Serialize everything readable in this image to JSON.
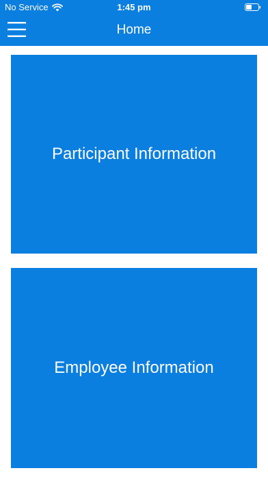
{
  "status_bar": {
    "carrier": "No Service",
    "time": "1:45 pm",
    "wifi_icon": "wifi-icon",
    "battery_icon": "battery-icon"
  },
  "nav": {
    "title": "Home",
    "menu_icon": "hamburger-menu-icon"
  },
  "tiles": [
    {
      "label": "Participant Information"
    },
    {
      "label": "Employee Information"
    }
  ],
  "colors": {
    "primary": "#0a7fe0",
    "background": "#ffffff",
    "text_on_primary": "#ffffff"
  }
}
